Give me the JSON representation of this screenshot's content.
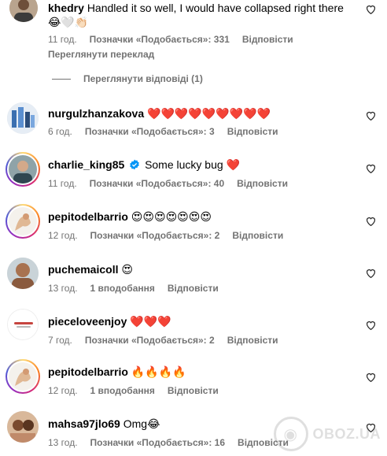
{
  "comments": [
    {
      "username": "khedry",
      "text": "Handled it so well, I would have collapsed right there",
      "text_line2": "😂🤍👏🏻",
      "time": "11 год.",
      "likes": "Позначки «Подобається»: 331",
      "reply": "Відповісти",
      "translate": "Переглянути переклад"
    },
    {
      "username": "nurgulzhanzakova",
      "text": "❤️❤️❤️❤️❤️❤️❤️❤️❤️",
      "time": "6 год.",
      "likes": "Позначки «Подобається»: 3",
      "reply": "Відповісти"
    },
    {
      "username": "charlie_king85",
      "text": "Some lucky bug ❤️",
      "time": "11 год.",
      "likes": "Позначки «Подобається»: 40",
      "reply": "Відповісти"
    },
    {
      "username": "pepitodelbarrio",
      "text": "😍😍😍😍😍😍😍",
      "time": "12 год.",
      "likes": "Позначки «Подобається»: 2",
      "reply": "Відповісти"
    },
    {
      "username": "puchemaicoll",
      "text": "😍",
      "time": "13 год.",
      "likes": "1 вподобання",
      "reply": "Відповісти"
    },
    {
      "username": "pieceloveenjoy",
      "text": "❤️❤️❤️",
      "time": "7 год.",
      "likes": "Позначки «Подобається»: 2",
      "reply": "Відповісти"
    },
    {
      "username": "pepitodelbarrio",
      "text": "🔥🔥🔥🔥",
      "time": "12 год.",
      "likes": "1 вподобання",
      "reply": "Відповісти"
    },
    {
      "username": "mahsa97jlo69",
      "text": "Omg😂",
      "time": "13 год.",
      "likes": "Позначки «Подобається»: 16",
      "reply": "Відповісти"
    }
  ],
  "replies_toggle": "Переглянути відповіді (1)",
  "watermark": "OBOZ.UA",
  "icons": {
    "like": "heart-outline-icon",
    "verified": "verified-badge-icon"
  },
  "colors": {
    "meta_text": "#737373",
    "verified": "#0095f6"
  }
}
